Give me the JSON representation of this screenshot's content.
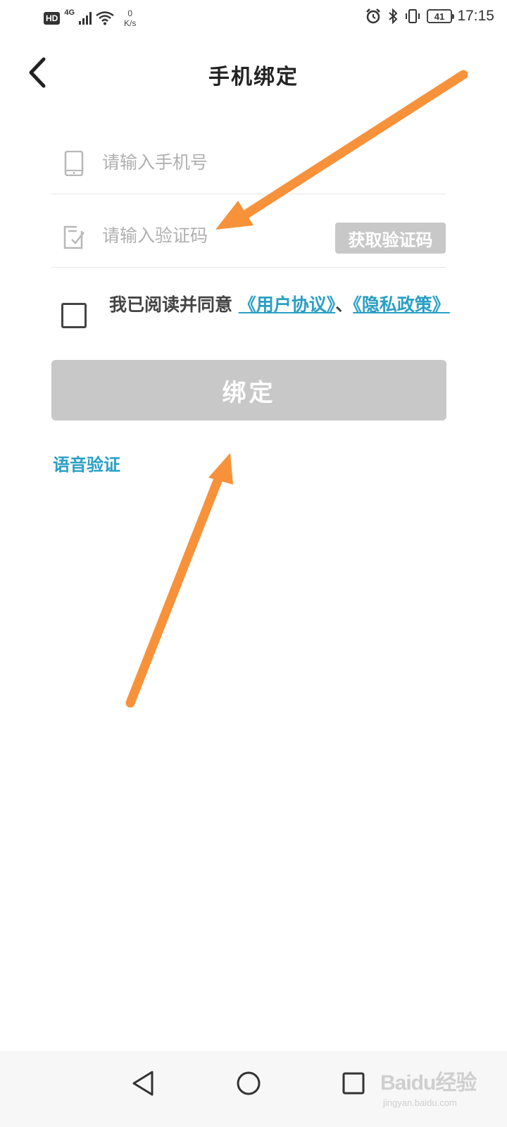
{
  "status_bar": {
    "hd": "HD",
    "network": "4G",
    "speed_value": "0",
    "speed_unit": "K/s",
    "battery": "41",
    "time": "17:15"
  },
  "header": {
    "title": "手机绑定"
  },
  "form": {
    "phone_placeholder": "请输入手机号",
    "code_placeholder": "请输入验证码",
    "get_code_label": "获取验证码",
    "agree_prefix": "我已阅读并同意 ",
    "user_agreement": "《用户协议》",
    "separator": "、",
    "privacy_policy": "《隐私政策》",
    "agree_checked": false,
    "bind_label": "绑定",
    "voice_verify": "语音验证"
  },
  "colors": {
    "accent": "#2a9fc4",
    "disabled_button": "#c8c8c8",
    "annotation_arrow": "#f7923a"
  },
  "icons": {
    "back": "chevron-left-icon",
    "phone": "phone-icon",
    "code": "checklist-icon",
    "nav_back": "triangle-back-icon",
    "nav_home": "circle-home-icon",
    "nav_recent": "square-recent-icon"
  },
  "watermark": {
    "brand": "Baidu经验",
    "site": "jingyan.baidu.com"
  }
}
